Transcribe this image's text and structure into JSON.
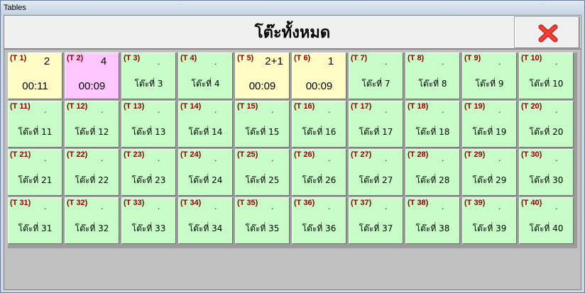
{
  "window": {
    "title": "Tables"
  },
  "header": {
    "title": "โต๊ะทั้งหมด",
    "close_icon": "close-x-icon",
    "close_color": "#e53935"
  },
  "colors": {
    "free": "#c8fcc8",
    "occupied": "#fffdc6",
    "pink": "#ffc6ff",
    "id_text": "#8b0000"
  },
  "tables": [
    {
      "id": "(T 1)",
      "guests": "2",
      "time": "00:11",
      "status": "occupied"
    },
    {
      "id": "(T 2)",
      "guests": "4",
      "time": "00:09",
      "status": "pink"
    },
    {
      "id": "(T 3)",
      "dot": ".",
      "name": "โต๊ะที่ 3",
      "status": "free"
    },
    {
      "id": "(T 4)",
      "dot": ".",
      "name": "โต๊ะที่ 4",
      "status": "free"
    },
    {
      "id": "(T 5)",
      "guests": "2+1",
      "time": "00:09",
      "status": "occupied"
    },
    {
      "id": "(T 6)",
      "guests": "1",
      "time": "00:09",
      "status": "occupied"
    },
    {
      "id": "(T 7)",
      "dot": ".",
      "name": "โต๊ะที่ 7",
      "status": "free"
    },
    {
      "id": "(T 8)",
      "dot": ".",
      "name": "โต๊ะที่ 8",
      "status": "free"
    },
    {
      "id": "(T 9)",
      "dot": ".",
      "name": "โต๊ะที่ 9",
      "status": "free"
    },
    {
      "id": "(T 10)",
      "dot": ".",
      "name": "โต๊ะที่ 10",
      "status": "free"
    },
    {
      "id": "(T 11)",
      "dot": ".",
      "name": "โต๊ะที่ 11",
      "status": "free"
    },
    {
      "id": "(T 12)",
      "dot": ".",
      "name": "โต๊ะที่ 12",
      "status": "free"
    },
    {
      "id": "(T 13)",
      "dot": ".",
      "name": "โต๊ะที่ 13",
      "status": "free"
    },
    {
      "id": "(T 14)",
      "dot": ".",
      "name": "โต๊ะที่ 14",
      "status": "free"
    },
    {
      "id": "(T 15)",
      "dot": ".",
      "name": "โต๊ะที่ 15",
      "status": "free"
    },
    {
      "id": "(T 16)",
      "dot": ".",
      "name": "โต๊ะที่ 16",
      "status": "free"
    },
    {
      "id": "(T 17)",
      "dot": ".",
      "name": "โต๊ะที่ 17",
      "status": "free"
    },
    {
      "id": "(T 18)",
      "dot": ".",
      "name": "โต๊ะที่ 18",
      "status": "free"
    },
    {
      "id": "(T 19)",
      "dot": ".",
      "name": "โต๊ะที่ 19",
      "status": "free"
    },
    {
      "id": "(T 20)",
      "dot": ".",
      "name": "โต๊ะที่ 20",
      "status": "free"
    },
    {
      "id": "(T 21)",
      "dot": ".",
      "name": "โต๊ะที่ 21",
      "status": "free"
    },
    {
      "id": "(T 22)",
      "dot": ".",
      "name": "โต๊ะที่ 22",
      "status": "free"
    },
    {
      "id": "(T 23)",
      "dot": ".",
      "name": "โต๊ะที่ 23",
      "status": "free"
    },
    {
      "id": "(T 24)",
      "dot": ".",
      "name": "โต๊ะที่ 24",
      "status": "free"
    },
    {
      "id": "(T 25)",
      "dot": ".",
      "name": "โต๊ะที่ 25",
      "status": "free"
    },
    {
      "id": "(T 26)",
      "dot": ".",
      "name": "โต๊ะที่ 26",
      "status": "free"
    },
    {
      "id": "(T 27)",
      "dot": ".",
      "name": "โต๊ะที่ 27",
      "status": "free"
    },
    {
      "id": "(T 28)",
      "dot": ".",
      "name": "โต๊ะที่ 28",
      "status": "free"
    },
    {
      "id": "(T 29)",
      "dot": ".",
      "name": "โต๊ะที่ 29",
      "status": "free"
    },
    {
      "id": "(T 30)",
      "dot": ".",
      "name": "โต๊ะที่ 30",
      "status": "free"
    },
    {
      "id": "(T 31)",
      "dot": ".",
      "name": "โต๊ะที่ 31",
      "status": "free"
    },
    {
      "id": "(T 32)",
      "dot": ".",
      "name": "โต๊ะที่ 32",
      "status": "free"
    },
    {
      "id": "(T 33)",
      "dot": ".",
      "name": "โต๊ะที่ 33",
      "status": "free"
    },
    {
      "id": "(T 34)",
      "dot": ".",
      "name": "โต๊ะที่ 34",
      "status": "free"
    },
    {
      "id": "(T 35)",
      "dot": ".",
      "name": "โต๊ะที่ 35",
      "status": "free"
    },
    {
      "id": "(T 36)",
      "dot": ".",
      "name": "โต๊ะที่ 36",
      "status": "free"
    },
    {
      "id": "(T 37)",
      "dot": ".",
      "name": "โต๊ะที่ 37",
      "status": "free"
    },
    {
      "id": "(T 38)",
      "dot": ".",
      "name": "โต๊ะที่ 38",
      "status": "free"
    },
    {
      "id": "(T 39)",
      "dot": ".",
      "name": "โต๊ะที่ 39",
      "status": "free"
    },
    {
      "id": "(T 40)",
      "dot": ".",
      "name": "โต๊ะที่ 40",
      "status": "free"
    }
  ]
}
